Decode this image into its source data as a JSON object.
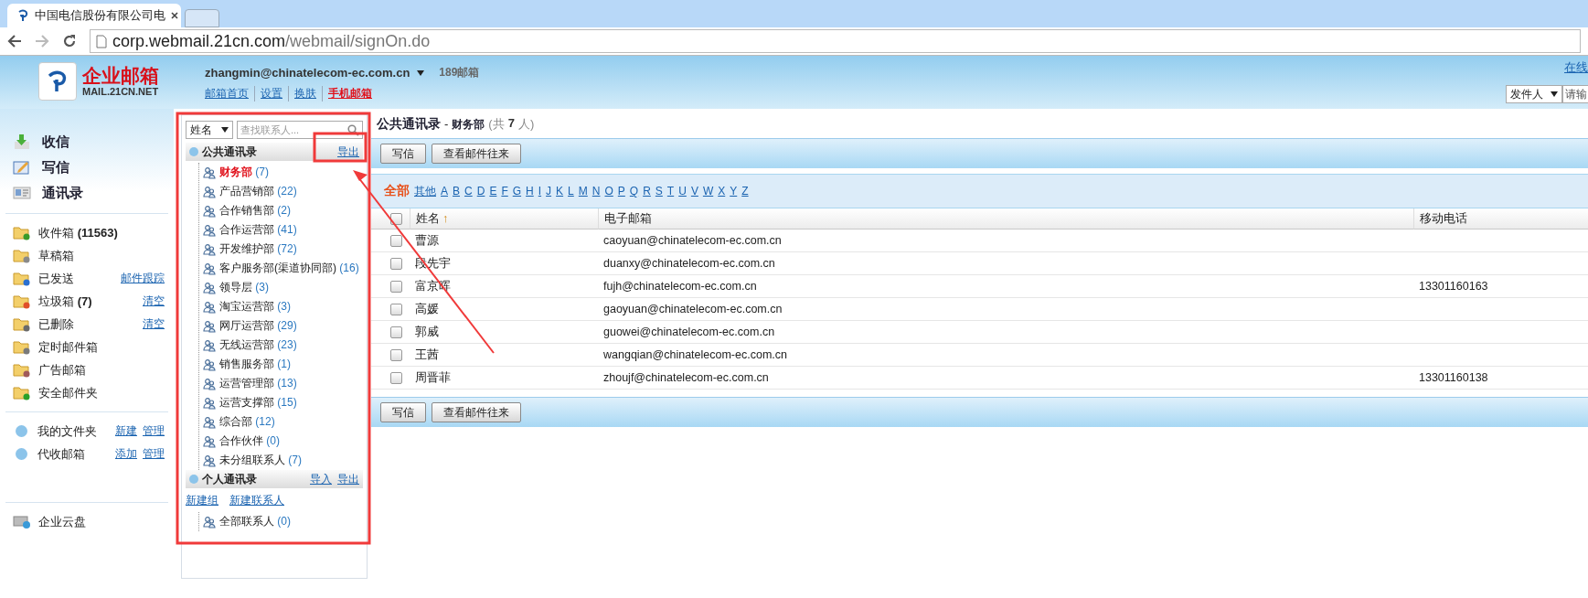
{
  "browser": {
    "tab_title": "中国电信股份有限公司电",
    "url_host": "corp.webmail.21cn.com",
    "url_path": "/webmail/signOn.do"
  },
  "header": {
    "logo_title": "企业邮箱",
    "logo_subtitle": "MAIL.21CN.NET",
    "account": "zhangmin@chinatelecom-ec.com.cn",
    "badge": "189邮箱",
    "links": [
      {
        "label": "邮箱首页",
        "highlight": false
      },
      {
        "label": "设置",
        "highlight": false
      },
      {
        "label": "换肤",
        "highlight": false
      },
      {
        "label": "手机邮箱",
        "highlight": true
      }
    ],
    "right_link": "在线",
    "search_scope": "发件人",
    "search_placeholder": "请输"
  },
  "nav": {
    "main": [
      {
        "label": "收信",
        "kind": "receive"
      },
      {
        "label": "写信",
        "kind": "compose"
      },
      {
        "label": "通讯录",
        "kind": "contacts"
      }
    ],
    "folders": [
      {
        "label": "收件箱",
        "count": "(11563)",
        "kind": "inbox"
      },
      {
        "label": "草稿箱",
        "kind": "drafts"
      },
      {
        "label": "已发送",
        "kind": "sent",
        "links": [
          "邮件跟踪"
        ]
      },
      {
        "label": "垃圾箱",
        "count": "(7)",
        "kind": "spam",
        "links": [
          "清空"
        ]
      },
      {
        "label": "已删除",
        "kind": "trash",
        "links": [
          "清空"
        ]
      },
      {
        "label": "定时邮件箱",
        "kind": "scheduled"
      },
      {
        "label": "广告邮箱",
        "kind": "ads"
      },
      {
        "label": "安全邮件夹",
        "kind": "secure"
      }
    ],
    "custom": [
      {
        "label": "我的文件夹",
        "links": [
          "新建",
          "管理"
        ]
      },
      {
        "label": "代收邮箱",
        "links": [
          "添加",
          "管理"
        ]
      }
    ],
    "cloud": "企业云盘"
  },
  "tree": {
    "filter": "姓名",
    "search_placeholder": "查找联系人...",
    "sections": [
      {
        "title": "公共通讯录",
        "actions": [
          "导出"
        ],
        "groups": [
          {
            "name": "财务部",
            "count": "(7)",
            "selected": true
          },
          {
            "name": "产品营销部",
            "count": "(22)",
            "selected": false
          },
          {
            "name": "合作销售部",
            "count": "(2)",
            "selected": false
          },
          {
            "name": "合作运营部",
            "count": "(41)",
            "selected": false
          },
          {
            "name": "开发维护部",
            "count": "(72)",
            "selected": false
          },
          {
            "name": "客户服务部(渠道协同部)",
            "count": "(16)",
            "selected": false
          },
          {
            "name": "领导层",
            "count": "(3)",
            "selected": false
          },
          {
            "name": "淘宝运营部",
            "count": "(3)",
            "selected": false
          },
          {
            "name": "网厅运营部",
            "count": "(29)",
            "selected": false
          },
          {
            "name": "无线运营部",
            "count": "(23)",
            "selected": false
          },
          {
            "name": "销售服务部",
            "count": "(1)",
            "selected": false
          },
          {
            "name": "运营管理部",
            "count": "(13)",
            "selected": false
          },
          {
            "name": "运营支撑部",
            "count": "(15)",
            "selected": false
          },
          {
            "name": "综合部",
            "count": "(12)",
            "selected": false
          },
          {
            "name": "合作伙伴",
            "count": "(0)",
            "selected": false
          },
          {
            "name": "未分组联系人",
            "count": "(7)",
            "selected": false
          }
        ]
      },
      {
        "title": "个人通讯录",
        "actions": [
          "导入",
          "导出"
        ],
        "links": [
          "新建组",
          "新建联系人"
        ],
        "groups": [
          {
            "name": "全部联系人",
            "count": "(0)",
            "selected": false
          }
        ]
      }
    ]
  },
  "main": {
    "title": "公共通讯录",
    "separator": "-",
    "group": "财务部",
    "total_prefix": "(共",
    "total": "7",
    "total_suffix": "人)",
    "top_buttons": [
      "写信",
      "查看邮件往来"
    ],
    "bottom_buttons": [
      "写信",
      "查看邮件往来"
    ],
    "letters": [
      {
        "label": "全部",
        "selected": true
      },
      {
        "label": "其他",
        "selected": false
      },
      {
        "label": "A",
        "selected": false
      },
      {
        "label": "B",
        "selected": false
      },
      {
        "label": "C",
        "selected": false
      },
      {
        "label": "D",
        "selected": false
      },
      {
        "label": "E",
        "selected": false
      },
      {
        "label": "F",
        "selected": false
      },
      {
        "label": "G",
        "selected": false
      },
      {
        "label": "H",
        "selected": false
      },
      {
        "label": "I",
        "selected": false
      },
      {
        "label": "J",
        "selected": false
      },
      {
        "label": "K",
        "selected": false
      },
      {
        "label": "L",
        "selected": false
      },
      {
        "label": "M",
        "selected": false
      },
      {
        "label": "N",
        "selected": false
      },
      {
        "label": "O",
        "selected": false
      },
      {
        "label": "P",
        "selected": false
      },
      {
        "label": "Q",
        "selected": false
      },
      {
        "label": "R",
        "selected": false
      },
      {
        "label": "S",
        "selected": false
      },
      {
        "label": "T",
        "selected": false
      },
      {
        "label": "U",
        "selected": false
      },
      {
        "label": "V",
        "selected": false
      },
      {
        "label": "W",
        "selected": false
      },
      {
        "label": "X",
        "selected": false
      },
      {
        "label": "Y",
        "selected": false
      },
      {
        "label": "Z",
        "selected": false
      }
    ],
    "columns": [
      {
        "label": "姓名",
        "sort": "↑"
      },
      {
        "label": "电子邮箱"
      },
      {
        "label": "移动电话"
      }
    ],
    "header_checked": false,
    "rows": [
      {
        "name": "曹源",
        "email": "caoyuan@chinatelecom-ec.com.cn",
        "checked": false
      },
      {
        "name": "段先宇",
        "email": "duanxy@chinatelecom-ec.com.cn",
        "checked": false
      },
      {
        "name": "富京晖",
        "email": "fujh@chinatelecom-ec.com.cn",
        "mobile": "13301160163",
        "checked": false
      },
      {
        "name": "高媛",
        "email": "gaoyuan@chinatelecom-ec.com.cn",
        "checked": false
      },
      {
        "name": "郭威",
        "email": "guowei@chinatelecom-ec.com.cn",
        "checked": false
      },
      {
        "name": "王茜",
        "email": "wangqian@chinatelecom-ec.com.cn",
        "checked": false
      },
      {
        "name": "周晋菲",
        "email": "zhoujf@chinatelecom-ec.com.cn",
        "mobile": "13301160138",
        "checked": false
      }
    ]
  }
}
